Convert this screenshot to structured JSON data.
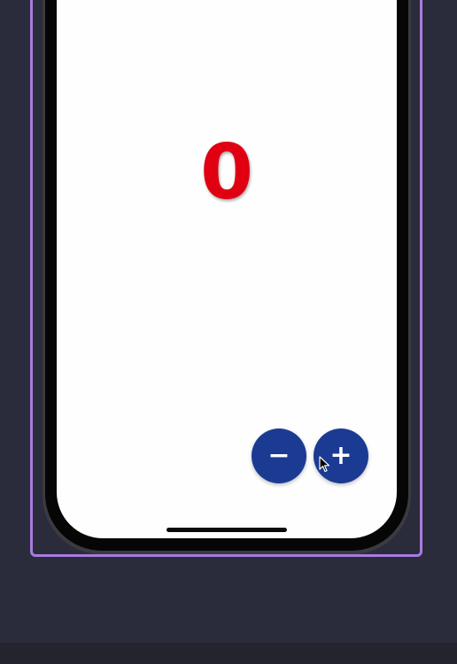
{
  "counter": {
    "value": "0",
    "color": "#e00012"
  },
  "buttons": {
    "decrement_label": "−",
    "increment_label": "+",
    "color": "#1b3b93"
  },
  "icons": {
    "decrement": "minus-icon",
    "increment": "plus-icon",
    "cursor": "mouse-pointer-icon"
  },
  "theme": {
    "background": "#2b2c3b",
    "selection_border": "#a87bdf",
    "screen": "#fefefe"
  }
}
